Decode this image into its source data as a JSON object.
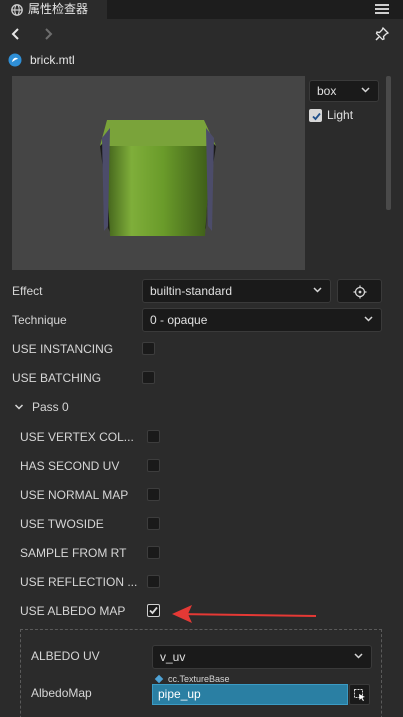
{
  "titlebar": {
    "tab_title": "属性检查器",
    "globe_icon": "globe-icon",
    "menu_icon": "hamburger-menu-icon"
  },
  "nav": {
    "back_icon": "chevron-left-icon",
    "forward_icon": "chevron-right-icon",
    "pin_icon": "pin-icon"
  },
  "file": {
    "name": "brick.mtl",
    "icon": "material-file-icon"
  },
  "preview": {
    "mesh_select": "box",
    "light_label": "Light",
    "light_checked": true,
    "model_color": "#6a9b2a"
  },
  "props": {
    "effect_label": "Effect",
    "effect_value": "builtin-standard",
    "technique_label": "Technique",
    "technique_value": "0 - opaque",
    "use_instancing_label": "USE INSTANCING",
    "use_batching_label": "USE BATCHING"
  },
  "pass": {
    "title": "Pass 0",
    "items": [
      {
        "label": "USE VERTEX COL...",
        "checked": false
      },
      {
        "label": "HAS SECOND UV",
        "checked": false
      },
      {
        "label": "USE NORMAL MAP",
        "checked": false
      },
      {
        "label": "USE TWOSIDE",
        "checked": false
      },
      {
        "label": "SAMPLE FROM RT",
        "checked": false
      },
      {
        "label": "USE REFLECTION ...",
        "checked": false
      },
      {
        "label": "USE ALBEDO MAP",
        "checked": true
      }
    ],
    "albedo_uv_label": "ALBEDO UV",
    "albedo_uv_value": "v_uv",
    "albedo_map_label": "AlbedoMap",
    "albedo_map_type": "cc.TextureBase",
    "albedo_map_value": "pipe_up"
  },
  "colors": {
    "accent": "#2a7fa3",
    "arrow": "#e53935",
    "background": "#2b2b2b"
  }
}
